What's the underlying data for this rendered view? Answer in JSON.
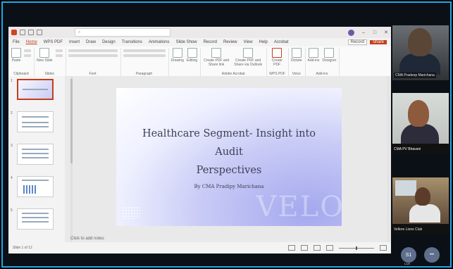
{
  "powerpoint": {
    "menu_tabs": [
      "File",
      "Home",
      "WPS PDF",
      "Insert",
      "Draw",
      "Design",
      "Transitions",
      "Animations",
      "Slide Show",
      "Record",
      "Review",
      "View",
      "Help",
      "Acrobat"
    ],
    "active_tab": "Home",
    "record_label": "Record",
    "share_label": "Share",
    "ribbon_groups": [
      {
        "label": "Clipboard",
        "buttons": [
          "Paste"
        ]
      },
      {
        "label": "Slides",
        "buttons": [
          "New Slide"
        ]
      },
      {
        "label": "Font",
        "buttons": []
      },
      {
        "label": "Paragraph",
        "buttons": []
      },
      {
        "label": "",
        "buttons": [
          "Drawing",
          "Editing"
        ]
      },
      {
        "label": "Adobe Acrobat",
        "buttons": [
          "Create PDF and Share link",
          "Create PDF and Share via Outlook"
        ]
      },
      {
        "label": "WPS PDF",
        "buttons": [
          "Create PDF"
        ]
      },
      {
        "label": "Voice",
        "buttons": [
          "Dictate"
        ]
      },
      {
        "label": "Add-ins",
        "buttons": [
          "Add-ins",
          "Designer"
        ]
      }
    ],
    "slide": {
      "title_line1": "Healthcare Segment- Insight into Audit",
      "title_line2": "Perspectives",
      "author": "By CMA Pradipy Marichana",
      "watermark": "VELO"
    },
    "thumbnail_numbers": [
      "1",
      "2",
      "3",
      "4",
      "5"
    ],
    "notes_placeholder": "Click to add notes",
    "status_left": "Slide 1 of 12"
  },
  "participants": [
    {
      "name": "CMA Pradeep Marichana"
    },
    {
      "name": "CMA PV Bhavani"
    },
    {
      "name": "Vellore Lions Club"
    }
  ],
  "self": {
    "initials": "S1",
    "label": "Live"
  },
  "more_label": "•••"
}
